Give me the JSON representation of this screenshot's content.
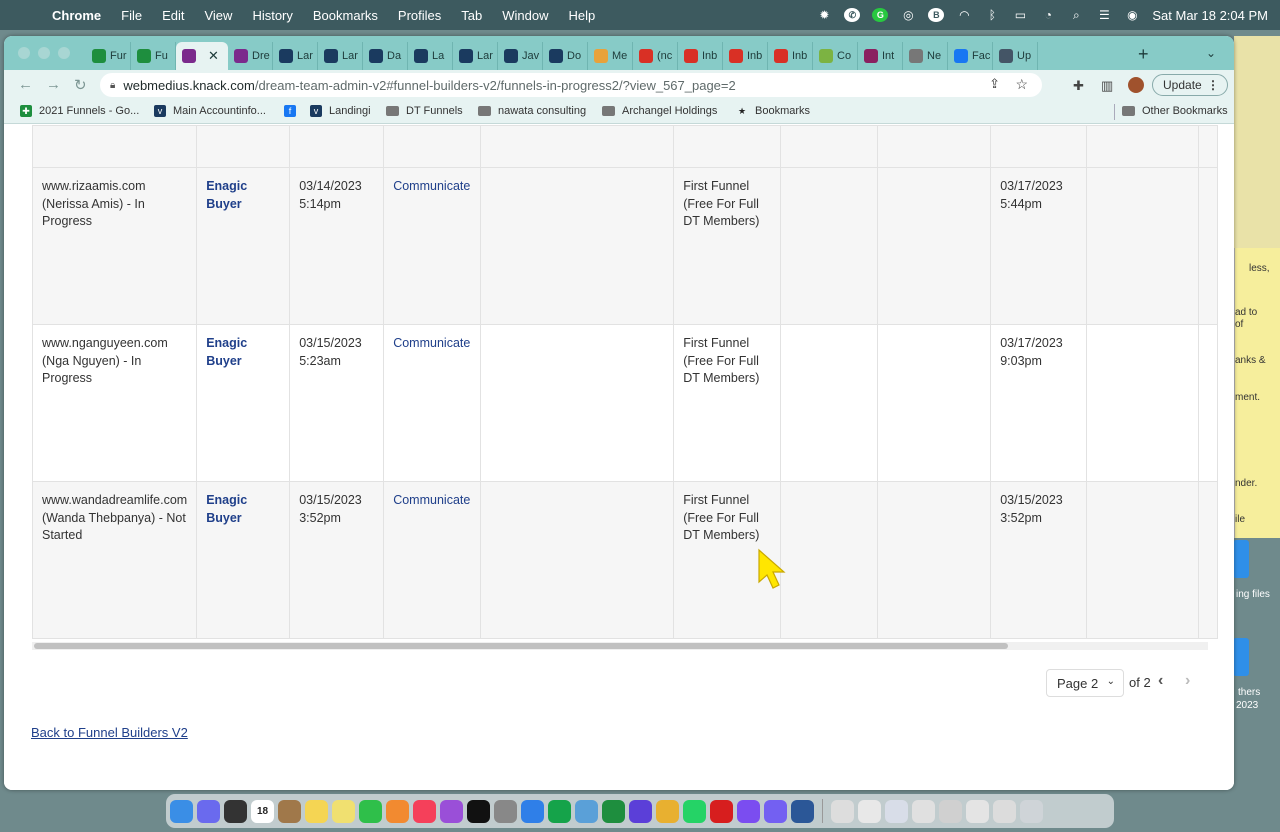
{
  "menubar": {
    "app": "Chrome",
    "items": [
      "File",
      "Edit",
      "View",
      "History",
      "Bookmarks",
      "Profiles",
      "Tab",
      "Window",
      "Help"
    ],
    "datetime": "Sat Mar 18  2:04 PM"
  },
  "tabs": [
    {
      "label": "Fur",
      "icon": "sheets-icon",
      "color": "#1e8e3e"
    },
    {
      "label": "Fu",
      "icon": "sheets-icon",
      "color": "#1e8e3e"
    },
    {
      "label": "",
      "icon": "knack-asterisk-icon",
      "color": "#7b2a8c",
      "active": true
    },
    {
      "label": "Dre",
      "icon": "knack-asterisk-icon",
      "color": "#7b2a8c"
    },
    {
      "label": "Lar",
      "icon": "knack-v-icon",
      "color": "#1a3a5f"
    },
    {
      "label": "Lar",
      "icon": "knack-v-icon",
      "color": "#1a3a5f"
    },
    {
      "label": "Da",
      "icon": "knack-v-icon",
      "color": "#1a3a5f"
    },
    {
      "label": "La",
      "icon": "knack-v-icon",
      "color": "#1a3a5f"
    },
    {
      "label": "Lar",
      "icon": "knack-v-icon",
      "color": "#1a3a5f"
    },
    {
      "label": "Jav",
      "icon": "knack-v-icon",
      "color": "#1a3a5f"
    },
    {
      "label": "Do",
      "icon": "knack-v-icon",
      "color": "#1a3a5f"
    },
    {
      "label": "Me",
      "icon": "sparkle-icon",
      "color": "#e8a23a"
    },
    {
      "label": "(nc",
      "icon": "gmail-icon",
      "color": "#d93025"
    },
    {
      "label": "Inb",
      "icon": "gmail-icon",
      "color": "#d93025"
    },
    {
      "label": "Inb",
      "icon": "gmail-icon",
      "color": "#d93025"
    },
    {
      "label": "Inb",
      "icon": "gmail-icon",
      "color": "#d93025"
    },
    {
      "label": "Co",
      "icon": "puzzle-icon",
      "color": "#7cb342"
    },
    {
      "label": "Int",
      "icon": "grid-icon",
      "color": "#8a2060"
    },
    {
      "label": "Ne",
      "icon": "openai-icon",
      "color": "#777777"
    },
    {
      "label": "Fac",
      "icon": "facebook-icon",
      "color": "#1877f2"
    },
    {
      "label": "Up",
      "icon": "cap-icon",
      "color": "#445566"
    }
  ],
  "address": {
    "host": "webmedius.knack.com",
    "path": "/dream-team-admin-v2#funnel-builders-v2/funnels-in-progress2/?view_567_page=2"
  },
  "toolbar": {
    "update_label": "Update"
  },
  "bookmarks": [
    {
      "label": "2021 Funnels - Go...",
      "icon": "sheets-icon"
    },
    {
      "label": "Main Accountinfo...",
      "icon": "knack-v-icon"
    },
    {
      "label": "",
      "icon": "facebook-icon"
    },
    {
      "label": "Landingi",
      "icon": "knack-v-icon"
    },
    {
      "label": "DT Funnels",
      "icon": "folder-icon"
    },
    {
      "label": "nawata consulting",
      "icon": "folder-icon"
    },
    {
      "label": "Archangel Holdings",
      "icon": "folder-icon"
    },
    {
      "label": "Bookmarks",
      "icon": "star-icon"
    },
    {
      "label": "Other Bookmarks",
      "icon": "folder-icon"
    }
  ],
  "table": {
    "rows": [
      {
        "funnel": "www.rizaamis.com (Nerissa Amis) - In Progress",
        "buyer": "Enagic Buyer",
        "created": "03/14/2023 5:14pm",
        "action": "Communicate",
        "blank1": "",
        "package": "First Funnel (Free For Full DT Members)",
        "blank2": "",
        "blank3": "",
        "updated": "03/17/2023 5:44pm",
        "blank4": ""
      },
      {
        "funnel": "www.nganguyeen.com (Nga Nguyen) - In Progress",
        "buyer": "Enagic Buyer",
        "created": "03/15/2023 5:23am",
        "action": "Communicate",
        "blank1": "",
        "package": "First Funnel (Free For Full DT Members)",
        "blank2": "",
        "blank3": "",
        "updated": "03/17/2023 9:03pm",
        "blank4": ""
      },
      {
        "funnel": "www.wandadreamlife.com (Wanda Thebpanya) - Not Started",
        "buyer": "Enagic Buyer",
        "created": "03/15/2023 3:52pm",
        "action": "Communicate",
        "blank1": "",
        "package": "First Funnel (Free For Full DT Members)",
        "blank2": "",
        "blank3": "",
        "updated": "03/15/2023 3:52pm",
        "blank4": ""
      }
    ]
  },
  "pagination": {
    "page_label": "Page 2",
    "of_label": "of 2"
  },
  "back_link": "Back to Funnel Builders V2",
  "desktop": {
    "yellow_fragments": [
      "less,",
      "ad to",
      "of",
      "anks &",
      "ment.",
      "nder.",
      "ile"
    ],
    "labels": [
      "ing files",
      "thers",
      "2023"
    ]
  },
  "dock": {
    "apps": [
      {
        "name": "finder",
        "color": "#3a8ee6"
      },
      {
        "name": "launchpad",
        "color": "#6a6aee"
      },
      {
        "name": "mission-control",
        "color": "#333333"
      },
      {
        "name": "calendar",
        "color": "#ffffff",
        "text": "18"
      },
      {
        "name": "contacts",
        "color": "#a0784a"
      },
      {
        "name": "notes",
        "color": "#f5d553"
      },
      {
        "name": "stickies",
        "color": "#f0e070"
      },
      {
        "name": "facetime",
        "color": "#2fbf4a"
      },
      {
        "name": "photos",
        "color": "#f28a30"
      },
      {
        "name": "music",
        "color": "#f5405a"
      },
      {
        "name": "podcasts",
        "color": "#9a4fd8"
      },
      {
        "name": "tv",
        "color": "#111111"
      },
      {
        "name": "settings",
        "color": "#888888"
      },
      {
        "name": "app-store",
        "color": "#2f7fe8"
      },
      {
        "name": "grammarly",
        "color": "#15a34a"
      },
      {
        "name": "preview",
        "color": "#5aa0d8"
      },
      {
        "name": "sheets",
        "color": "#1e8e3e"
      },
      {
        "name": "imovie",
        "color": "#5b3fd8"
      },
      {
        "name": "chrome",
        "color": "#e8b030"
      },
      {
        "name": "whatsapp",
        "color": "#25d366"
      },
      {
        "name": "acrobat",
        "color": "#d71e1e"
      },
      {
        "name": "messenger",
        "color": "#7b4df0"
      },
      {
        "name": "viber",
        "color": "#7360f2"
      },
      {
        "name": "word",
        "color": "#2b5797"
      },
      {
        "name": "window-1",
        "color": "#dddddd"
      },
      {
        "name": "window-2",
        "color": "#e8e8e8"
      },
      {
        "name": "window-3",
        "color": "#d8dde8"
      },
      {
        "name": "window-4",
        "color": "#e0e0e0"
      },
      {
        "name": "window-5",
        "color": "#d0d0d0"
      },
      {
        "name": "window-6",
        "color": "#e4e4e4"
      },
      {
        "name": "window-7",
        "color": "#dcdcdc"
      },
      {
        "name": "trash",
        "color": "#cfd4d8"
      }
    ]
  },
  "colors": {
    "menubar": "#3d5a5f",
    "tabstrip": "#87cbc7",
    "toolbar": "#e7f3f2",
    "link": "#1f3f8a",
    "cursor": "#ffe600"
  }
}
